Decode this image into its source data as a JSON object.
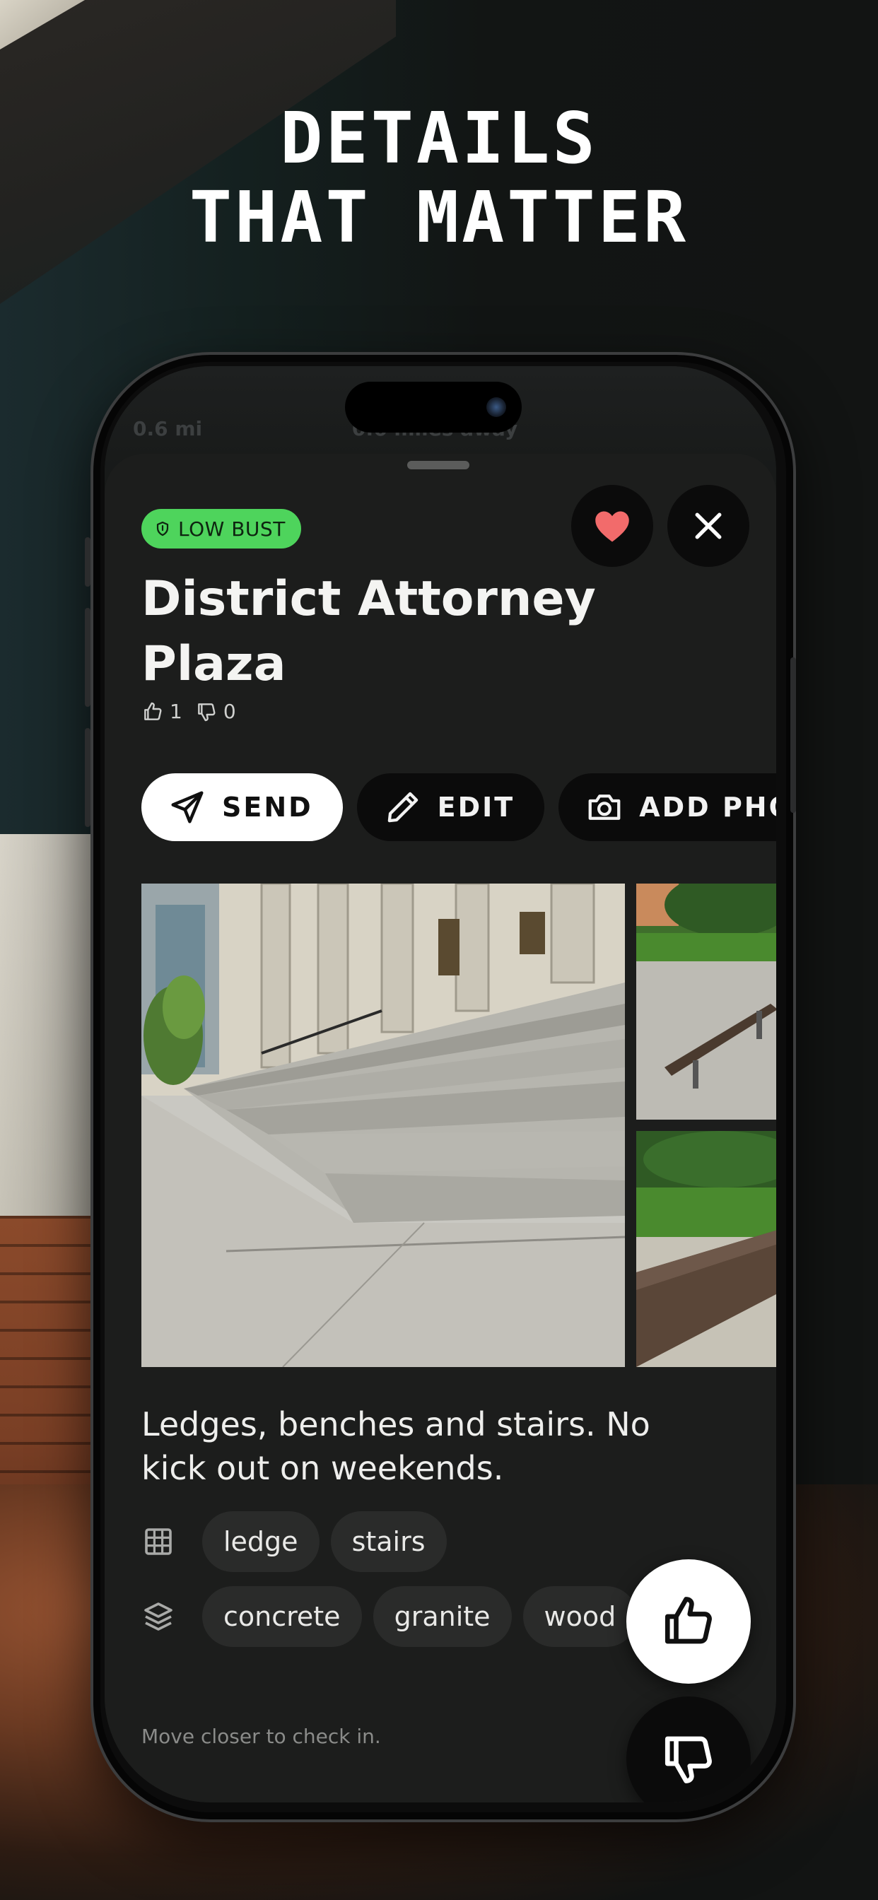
{
  "headline": {
    "line1": "DETAILS",
    "line2": "THAT MATTER"
  },
  "map": {
    "distance_left": "0.6 mi",
    "distance_right": "0.6 miles away"
  },
  "spot": {
    "badge": "LOW BUST",
    "title_line1": "District Attorney",
    "title_line2": "Plaza",
    "upvotes": "1",
    "downvotes": "0",
    "description": "Ledges, benches and stairs. No kick out on weekends."
  },
  "actions": {
    "send": "SEND",
    "edit": "EDIT",
    "add_photo": "ADD PHOTO"
  },
  "obstacles": [
    "ledge",
    "stairs"
  ],
  "materials": [
    "concrete",
    "granite",
    "wood"
  ],
  "hint": "Move closer to check in.",
  "colors": {
    "badge_green": "#4ED45C",
    "heart_red": "#F26B6B",
    "sheet_bg": "#1C1D1C"
  },
  "icons": [
    "heart-icon",
    "close-icon",
    "thumbs-up-icon",
    "thumbs-down-icon",
    "send-icon",
    "pencil-icon",
    "camera-icon",
    "grid-icon",
    "layers-icon",
    "shield-icon"
  ]
}
